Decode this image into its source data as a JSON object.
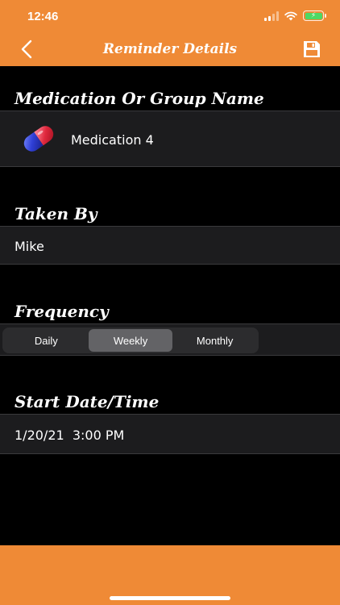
{
  "status_bar": {
    "time": "12:46"
  },
  "nav": {
    "title": "Reminder Details",
    "back_icon": "chevron-left-icon",
    "save_icon": "floppy-save-icon"
  },
  "sections": {
    "medication": {
      "title": "Medication Or Group Name",
      "value": "Medication 4",
      "icon": "pill-icon"
    },
    "taken_by": {
      "title": "Taken By",
      "value": "Mike"
    },
    "frequency": {
      "title": "Frequency",
      "options": [
        "Daily",
        "Weekly",
        "Monthly"
      ],
      "selected": "Weekly"
    },
    "start": {
      "title": "Start Date/Time",
      "value": "1/20/21  3:00 PM"
    }
  },
  "colors": {
    "accent": "#ef8a36",
    "row_bg": "#1c1c1e",
    "segment_bg": "#2c2c2e",
    "segment_active": "#636366"
  }
}
